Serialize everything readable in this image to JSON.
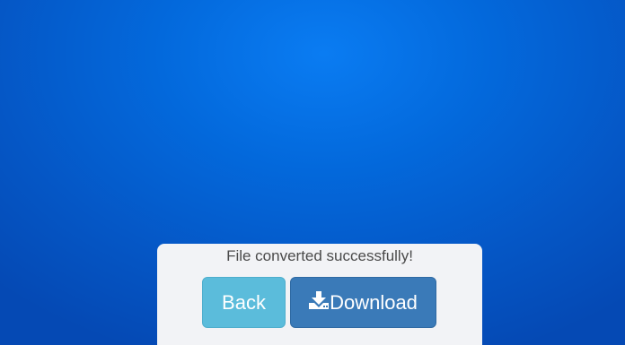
{
  "dialog": {
    "message": "File converted successfully!",
    "back_label": "Back",
    "download_label": "Download"
  },
  "icons": {
    "download": "download-icon"
  },
  "colors": {
    "background": "#0569dc",
    "panel": "#f2f3f6",
    "back_button": "#5bbcdb",
    "download_button": "#3a7ab8",
    "message_text": "#4a4a4a"
  }
}
